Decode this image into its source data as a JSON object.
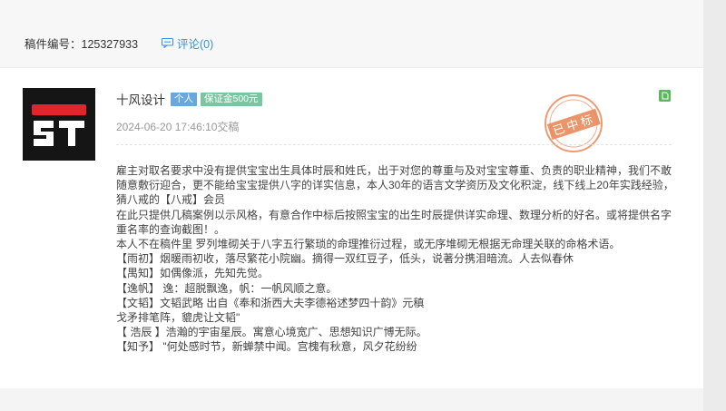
{
  "manuscript": {
    "id_label": "稿件编号：125327933",
    "comment_label": "评论(0)"
  },
  "designer": {
    "name": "十风设计",
    "badges": [
      "个人",
      "保证金500元"
    ],
    "submit_time": "2024-06-20 17:46:10交稿",
    "stamp_text": "已中标"
  },
  "content": {
    "paragraphs": [
      "雇主对取名要求中没有提供宝宝出生具体时辰和姓氏，出于对您的尊重与及对宝宝尊重、负责的职业精神，我们不敢随意敷衍迎合，更不能给宝宝提供八字的详实信息，本人30年的语言文学资历及文化积淀，线下线上20年实践经验，猜八戒的【八戒】会员",
      "在此只提供几稿案例以示风格，有意合作中标后按照宝宝的出生时辰提供详实命理、数理分析的好名。或将提供名字重名率的查询截图！。",
      "本人不在稿件里 罗列堆砌关于八字五行繁琐的命理推衍过程，或无序堆砌无根据无命理关联的命格术语。",
      "【雨初】烟暖雨初收，落尽繁花小院幽。摘得一双红豆子，低头，说著分携泪暗流。人去似春休",
      "【禺知】如偶像派，先知先觉。",
      "【逸帆】 逸：超脱飘逸，帆：一帆风顺之意。",
      "【文韬】文韬武略  出自《奉和浙西大夫李德裕述梦四十韵》元稹",
      "戈矛排笔阵，貔虎让文韬\"",
      "【 浩辰 】浩瀚的宇宙星辰。寓意心境宽广、思想知识广博无际。",
      "【知予】 \"何处感时节，新蝉禁中闻。宫槐有秋意，风夕花纷纷"
    ]
  },
  "colors": {
    "link": "#3b8fdc",
    "badge_personal": "#68a8dc",
    "badge_deposit": "#7cc5a1",
    "stamp": "#e88a5a",
    "doc_icon": "#5cb85c"
  },
  "icons": {
    "comment": "comment-bubble-icon",
    "document": "document-icon",
    "avatar": "designer-logo"
  }
}
